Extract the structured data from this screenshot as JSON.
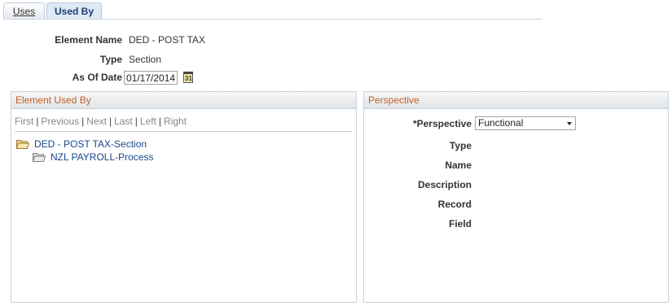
{
  "tabs": [
    {
      "label": "Uses",
      "active": false
    },
    {
      "label": "Used By",
      "active": true
    }
  ],
  "header": {
    "element_name_label": "Element Name",
    "element_name_value": "DED - POST TAX",
    "type_label": "Type",
    "type_value": "Section",
    "as_of_date_label": "As Of Date",
    "as_of_date_value": "01/17/2014",
    "calendar_icon": "calendar-icon"
  },
  "element_used_by": {
    "title": "Element Used By",
    "nav": [
      "First",
      "Previous",
      "Next",
      "Last",
      "Left",
      "Right"
    ],
    "tree": [
      {
        "label": "DED - POST TAX-Section",
        "level": 0,
        "icon": "folder-open-icon"
      },
      {
        "label": "NZL PAYROLL-Process",
        "level": 1,
        "icon": "folder-open-icon"
      }
    ]
  },
  "perspective": {
    "title": "Perspective",
    "perspective_label": "*Perspective",
    "perspective_value": "Functional",
    "fields": [
      "Type",
      "Name",
      "Description",
      "Record",
      "Field"
    ]
  },
  "colors": {
    "group_title": "#bf5f26",
    "link": "#17468a",
    "active_tab": "#1f3f73"
  }
}
